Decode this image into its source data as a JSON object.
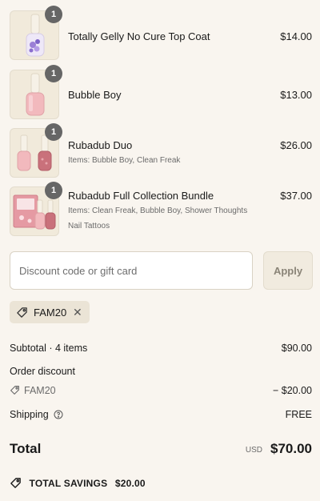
{
  "line_items": [
    {
      "name": "Totally Gelly No Cure Top Coat",
      "sub": "",
      "sub2": "",
      "price": "$14.00",
      "qty": "1"
    },
    {
      "name": "Bubble Boy",
      "sub": "",
      "sub2": "",
      "price": "$13.00",
      "qty": "1"
    },
    {
      "name": "Rubadub Duo",
      "sub": "Items: Bubble Boy, Clean Freak",
      "sub2": "",
      "price": "$26.00",
      "qty": "1"
    },
    {
      "name": "Rubadub Full Collection Bundle",
      "sub": "Items: Clean Freak, Bubble Boy, Shower Thoughts",
      "sub2": "Nail Tattoos",
      "price": "$37.00",
      "qty": "1"
    }
  ],
  "discount": {
    "placeholder": "Discount code or gift card",
    "apply_label": "Apply",
    "applied_code": "FAM20",
    "remove_symbol": "✕"
  },
  "summary": {
    "subtotal_label": "Subtotal · 4 items",
    "subtotal_value": "$90.00",
    "order_discount_label": "Order discount",
    "discount_code": "FAM20",
    "discount_value": "− $20.00",
    "shipping_label": "Shipping",
    "shipping_value": "FREE",
    "total_label": "Total",
    "currency": "USD",
    "total_value": "$70.00",
    "savings_label": "TOTAL SAVINGS",
    "savings_value": "$20.00"
  },
  "colors": {
    "background": "#f9f5ef",
    "badge": "#666666",
    "chip": "#ebe4d6"
  },
  "icons": {
    "tag": "tag-icon",
    "info": "info-circle-icon",
    "remove": "close-icon"
  }
}
